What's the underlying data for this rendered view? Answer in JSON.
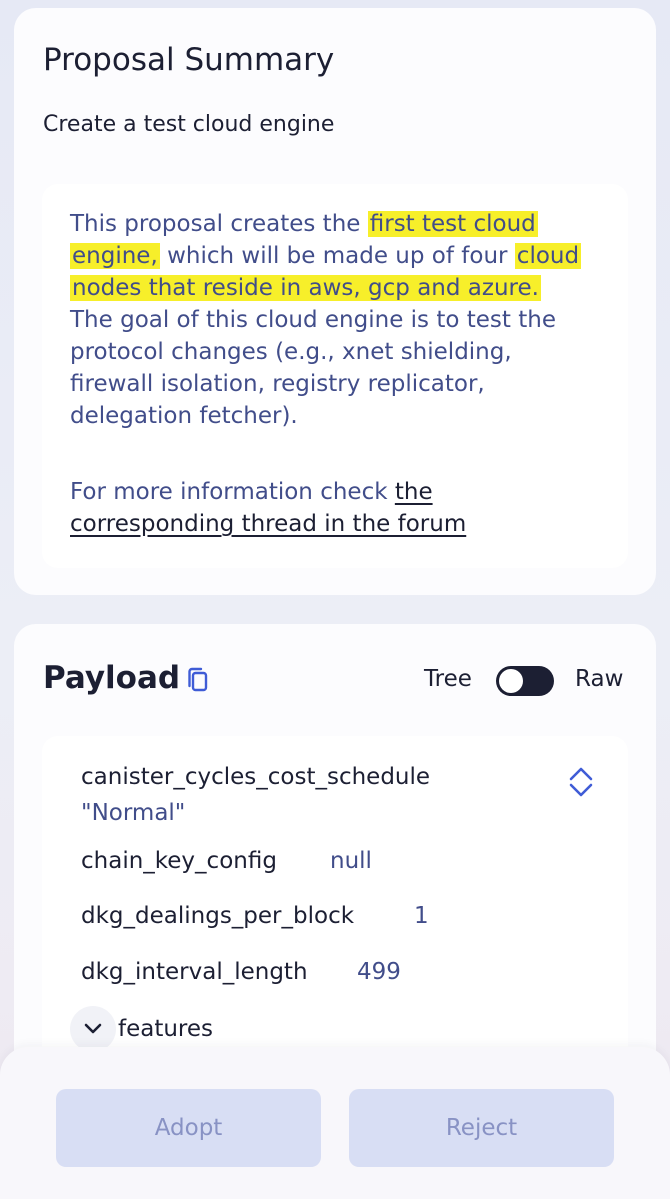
{
  "summary": {
    "title": "Proposal Summary",
    "subtitle": "Create a test cloud engine",
    "text_1": "This proposal creates the ",
    "highlight_1": "first test cloud engine,",
    "text_2": " which will be made up of four ",
    "highlight_2": "cloud nodes that reside in aws, gcp and azure.",
    "text_3": " The goal of this cloud engine is to test the protocol changes (e.g., xnet shielding, firewall isolation, registry replicator, delegation fetcher).",
    "more_info": "For more information check ",
    "forum_link": "the corresponding thread in the forum"
  },
  "payload": {
    "title": "Payload",
    "toggle": {
      "left_label": "Tree",
      "right_label": "Raw"
    },
    "fields": [
      {
        "key": "canister_cycles_cost_schedule",
        "value": "\"Normal\""
      },
      {
        "key": "chain_key_config",
        "value": "null"
      },
      {
        "key": "dkg_dealings_per_block",
        "value": "1"
      },
      {
        "key": "dkg_interval_length",
        "value": "499"
      }
    ],
    "features_label": "features"
  },
  "actions": {
    "adopt": "Adopt",
    "reject": "Reject"
  },
  "icons": {
    "copy": "copy-icon",
    "sort": "sort-icon",
    "chevron": "chevron-down-icon"
  },
  "colors": {
    "highlight": "#f7ef2a",
    "value_text": "#414d8a",
    "disabled_button": "#d8def4",
    "toggle_dark": "#1c1f33"
  }
}
